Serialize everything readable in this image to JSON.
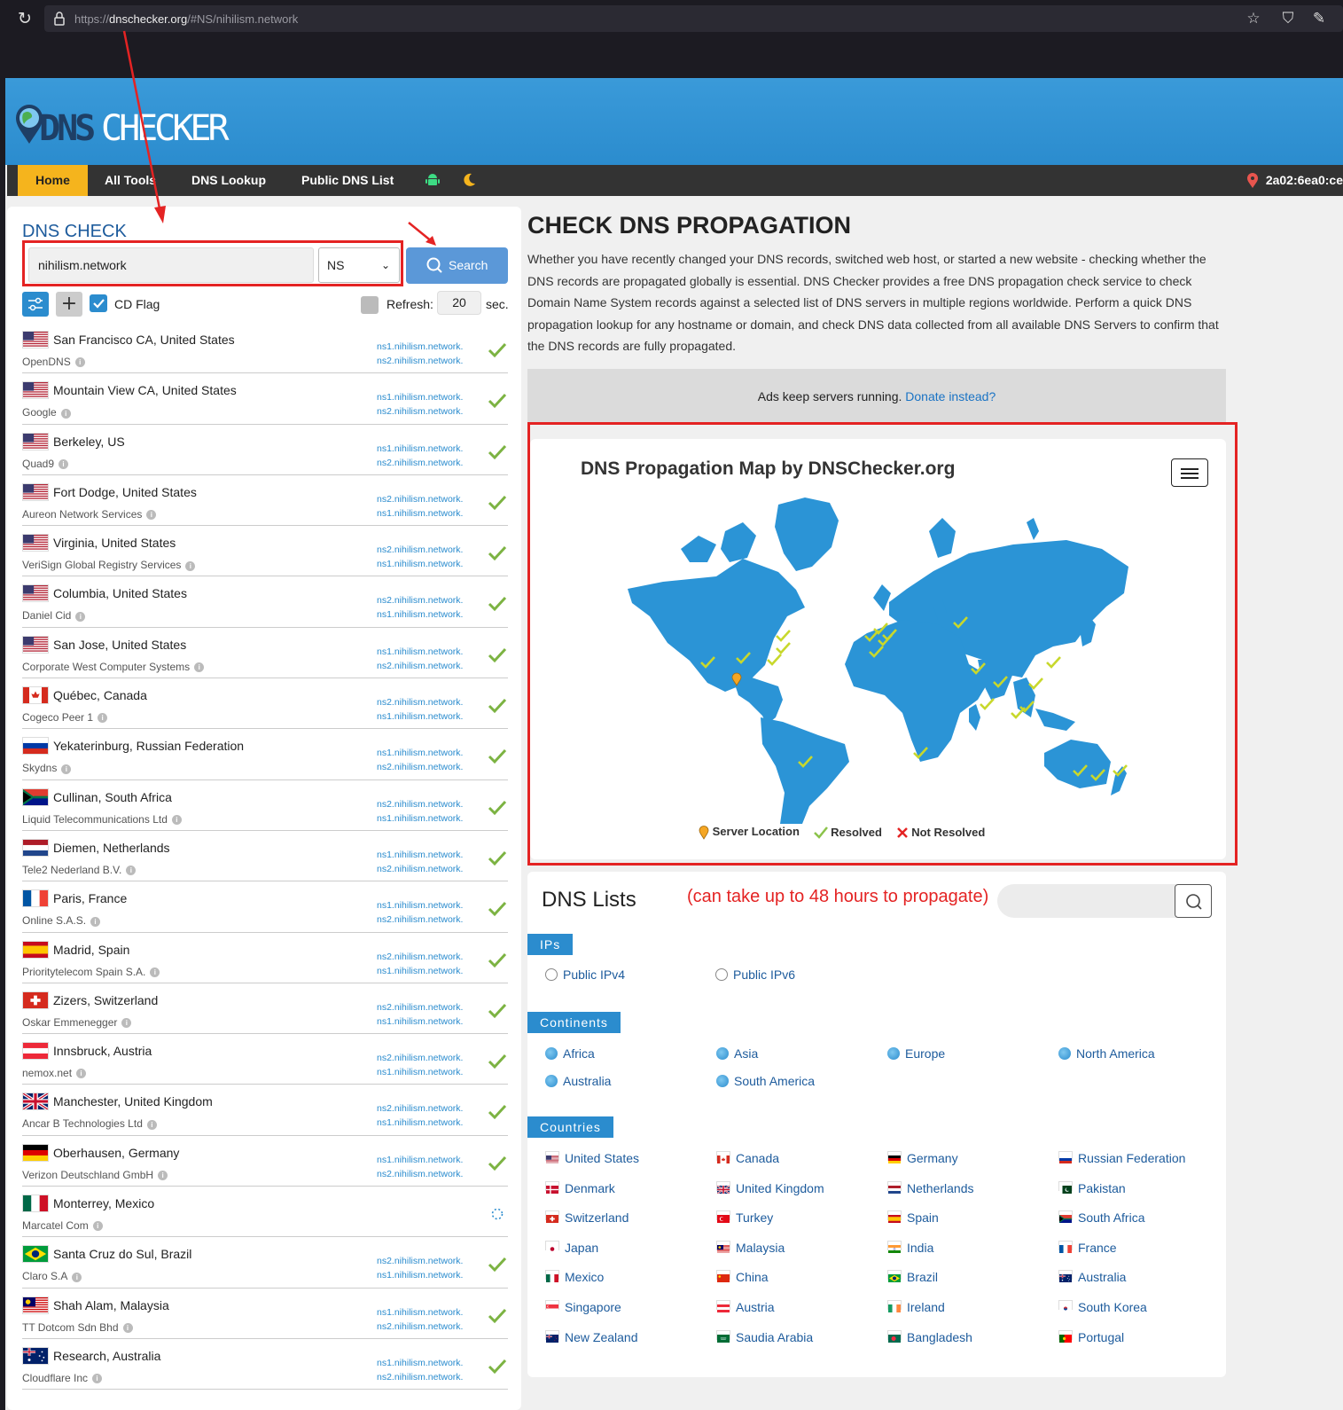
{
  "browser": {
    "url_prefix": "https://",
    "url_domain": "dnschecker.org",
    "url_path": "/#NS/nihilism.network"
  },
  "nav": {
    "items": [
      "Home",
      "All Tools",
      "DNS Lookup",
      "Public DNS List"
    ],
    "ip": "2a02:6ea0:ce"
  },
  "check": {
    "title": "DNS CHECK",
    "domain": "nihilism.network",
    "type": "NS",
    "search_label": "Search",
    "cd_flag": "CD Flag",
    "refresh_label": "Refresh:",
    "refresh_value": "20",
    "sec_label": "sec."
  },
  "servers": [
    {
      "location": "San Francisco CA, United States",
      "provider": "OpenDNS",
      "flag": "us",
      "ns": [
        "ns1.nihilism.network.",
        "ns2.nihilism.network."
      ],
      "status": "resolved"
    },
    {
      "location": "Mountain View CA, United States",
      "provider": "Google",
      "flag": "us",
      "ns": [
        "ns1.nihilism.network.",
        "ns2.nihilism.network."
      ],
      "status": "resolved"
    },
    {
      "location": "Berkeley, US",
      "provider": "Quad9",
      "flag": "us",
      "ns": [
        "ns1.nihilism.network.",
        "ns2.nihilism.network."
      ],
      "status": "resolved"
    },
    {
      "location": "Fort Dodge, United States",
      "provider": "Aureon Network Services",
      "flag": "us",
      "ns": [
        "ns2.nihilism.network.",
        "ns1.nihilism.network."
      ],
      "status": "resolved"
    },
    {
      "location": "Virginia, United States",
      "provider": "VeriSign Global Registry Services",
      "flag": "us",
      "ns": [
        "ns2.nihilism.network.",
        "ns1.nihilism.network."
      ],
      "status": "resolved"
    },
    {
      "location": "Columbia, United States",
      "provider": "Daniel Cid",
      "flag": "us",
      "ns": [
        "ns2.nihilism.network.",
        "ns1.nihilism.network."
      ],
      "status": "resolved"
    },
    {
      "location": "San Jose, United States",
      "provider": "Corporate West Computer Systems",
      "flag": "us",
      "ns": [
        "ns1.nihilism.network.",
        "ns2.nihilism.network."
      ],
      "status": "resolved"
    },
    {
      "location": "Québec, Canada",
      "provider": "Cogeco Peer 1",
      "flag": "ca",
      "ns": [
        "ns2.nihilism.network.",
        "ns1.nihilism.network."
      ],
      "status": "resolved"
    },
    {
      "location": "Yekaterinburg, Russian Federation",
      "provider": "Skydns",
      "flag": "ru",
      "ns": [
        "ns1.nihilism.network.",
        "ns2.nihilism.network."
      ],
      "status": "resolved"
    },
    {
      "location": "Cullinan, South Africa",
      "provider": "Liquid Telecommunications Ltd",
      "flag": "za",
      "ns": [
        "ns2.nihilism.network.",
        "ns1.nihilism.network."
      ],
      "status": "resolved"
    },
    {
      "location": "Diemen, Netherlands",
      "provider": "Tele2 Nederland B.V.",
      "flag": "nl",
      "ns": [
        "ns1.nihilism.network.",
        "ns2.nihilism.network."
      ],
      "status": "resolved"
    },
    {
      "location": "Paris, France",
      "provider": "Online S.A.S.",
      "flag": "fr",
      "ns": [
        "ns1.nihilism.network.",
        "ns2.nihilism.network."
      ],
      "status": "resolved"
    },
    {
      "location": "Madrid, Spain",
      "provider": "Prioritytelecom Spain S.A.",
      "flag": "es",
      "ns": [
        "ns2.nihilism.network.",
        "ns1.nihilism.network."
      ],
      "status": "resolved"
    },
    {
      "location": "Zizers, Switzerland",
      "provider": "Oskar Emmenegger",
      "flag": "ch",
      "ns": [
        "ns2.nihilism.network.",
        "ns1.nihilism.network."
      ],
      "status": "resolved"
    },
    {
      "location": "Innsbruck, Austria",
      "provider": "nemox.net",
      "flag": "at",
      "ns": [
        "ns2.nihilism.network.",
        "ns1.nihilism.network."
      ],
      "status": "resolved"
    },
    {
      "location": "Manchester, United Kingdom",
      "provider": "Ancar B Technologies Ltd",
      "flag": "gb",
      "ns": [
        "ns2.nihilism.network.",
        "ns1.nihilism.network."
      ],
      "status": "resolved"
    },
    {
      "location": "Oberhausen, Germany",
      "provider": "Verizon Deutschland GmbH",
      "flag": "de",
      "ns": [
        "ns1.nihilism.network.",
        "ns2.nihilism.network."
      ],
      "status": "resolved"
    },
    {
      "location": "Monterrey, Mexico",
      "provider": "Marcatel Com",
      "flag": "mx",
      "ns": [],
      "status": "loading"
    },
    {
      "location": "Santa Cruz do Sul, Brazil",
      "provider": "Claro S.A",
      "flag": "br",
      "ns": [
        "ns2.nihilism.network.",
        "ns1.nihilism.network."
      ],
      "status": "resolved"
    },
    {
      "location": "Shah Alam, Malaysia",
      "provider": "TT Dotcom Sdn Bhd",
      "flag": "my",
      "ns": [
        "ns1.nihilism.network.",
        "ns2.nihilism.network."
      ],
      "status": "resolved"
    },
    {
      "location": "Research, Australia",
      "provider": "Cloudflare Inc",
      "flag": "au",
      "ns": [
        "ns1.nihilism.network.",
        "ns2.nihilism.network."
      ],
      "status": "resolved"
    }
  ],
  "propagation": {
    "title": "CHECK DNS PROPAGATION",
    "intro": "Whether you have recently changed your DNS records, switched web host, or started a new website - checking whether the DNS records are propagated globally is essential. DNS Checker provides a free DNS propagation check service to check Domain Name System records against a selected list of DNS servers in multiple regions worldwide. Perform a quick DNS propagation lookup for any hostname or domain, and check DNS data collected from all available DNS Servers to confirm that the DNS records are fully propagated.",
    "ads_text": "Ads keep servers running.",
    "ads_link": "Donate instead?"
  },
  "map": {
    "title": "DNS Propagation Map by DNSChecker.org",
    "legend_server": "Server Location",
    "legend_resolved": "Resolved",
    "legend_not": "Not Resolved",
    "land_color": "#2b94d6",
    "check_color": "#c8d82c"
  },
  "lists": {
    "title": "DNS Lists",
    "annotation": "(can take up to 48 hours to propagate)",
    "ips_tag": "IPs",
    "ips": [
      "Public IPv4",
      "Public IPv6"
    ],
    "continents_tag": "Continents",
    "continents": [
      "Africa",
      "Asia",
      "Europe",
      "North America",
      "Australia",
      "South America"
    ],
    "countries_tag": "Countries",
    "countries": [
      {
        "name": "United States",
        "flag": "us"
      },
      {
        "name": "Canada",
        "flag": "ca"
      },
      {
        "name": "Germany",
        "flag": "de"
      },
      {
        "name": "Russian Federation",
        "flag": "ru"
      },
      {
        "name": "Denmark",
        "flag": "dk"
      },
      {
        "name": "United Kingdom",
        "flag": "gb"
      },
      {
        "name": "Netherlands",
        "flag": "nl"
      },
      {
        "name": "Pakistan",
        "flag": "pk"
      },
      {
        "name": "Switzerland",
        "flag": "ch"
      },
      {
        "name": "Turkey",
        "flag": "tr"
      },
      {
        "name": "Spain",
        "flag": "es"
      },
      {
        "name": "South Africa",
        "flag": "za"
      },
      {
        "name": "Japan",
        "flag": "jp"
      },
      {
        "name": "Malaysia",
        "flag": "my"
      },
      {
        "name": "India",
        "flag": "in"
      },
      {
        "name": "France",
        "flag": "fr"
      },
      {
        "name": "Mexico",
        "flag": "mx"
      },
      {
        "name": "China",
        "flag": "cn"
      },
      {
        "name": "Brazil",
        "flag": "br"
      },
      {
        "name": "Australia",
        "flag": "au"
      },
      {
        "name": "Singapore",
        "flag": "sg"
      },
      {
        "name": "Austria",
        "flag": "at"
      },
      {
        "name": "Ireland",
        "flag": "ie"
      },
      {
        "name": "South Korea",
        "flag": "kr"
      },
      {
        "name": "New Zealand",
        "flag": "nz"
      },
      {
        "name": "Saudia Arabia",
        "flag": "sa"
      },
      {
        "name": "Bangladesh",
        "flag": "bd"
      },
      {
        "name": "Portugal",
        "flag": "pt"
      }
    ]
  }
}
